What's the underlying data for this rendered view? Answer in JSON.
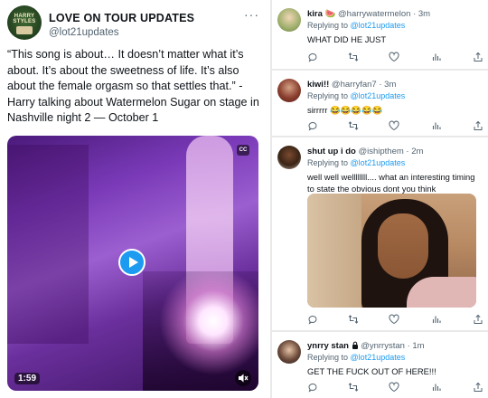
{
  "main_tweet": {
    "author_name": "LOVE ON TOUR UPDATES",
    "handle": "@lot21updates",
    "body": "“This song is about… It doesn’t matter what it’s about. It’s about the sweetness of life. It’s also about the female orgasm so that settles that.” - Harry talking about Watermelon Sugar on stage in Nashville night 2 — October 1",
    "avatar_text": "HARRY STYLES",
    "more_glyph": "···",
    "video": {
      "duration": "1:59",
      "cc_label": "CC",
      "accent": "#1d9bf0"
    }
  },
  "replies": [
    {
      "name": "kira 🍉",
      "handle": "@harrywatermelon",
      "time": "3m",
      "replying_prefix": "Replying to",
      "replying_to": "@lot21updates",
      "text": "WHAT DID HE JUST"
    },
    {
      "name": "kiwi!!",
      "handle": "@harryfan7",
      "time": "3m",
      "replying_prefix": "Replying to",
      "replying_to": "@lot21updates",
      "text": "sirrrrr 😂😂😂😂😂"
    },
    {
      "name": "shut up i do",
      "handle": "@ishipthem",
      "time": "2m",
      "replying_prefix": "Replying to",
      "replying_to": "@lot21updates",
      "text": "well well wellllllll.... what an interesting timing to state the obvious dont you think"
    },
    {
      "name": "ynrry stan",
      "handle": "@ynrrystan",
      "time": "1m",
      "replying_prefix": "Replying to",
      "replying_to": "@lot21updates",
      "text": "GET THE FUCK OUT OF HERE!!!"
    }
  ],
  "icons": {
    "reply": "comment-icon",
    "retweet": "retweet-icon",
    "like": "heart-icon",
    "analytics": "analytics-icon",
    "share": "share-icon"
  },
  "colors": {
    "link": "#1d9bf0",
    "muted": "#536471"
  }
}
